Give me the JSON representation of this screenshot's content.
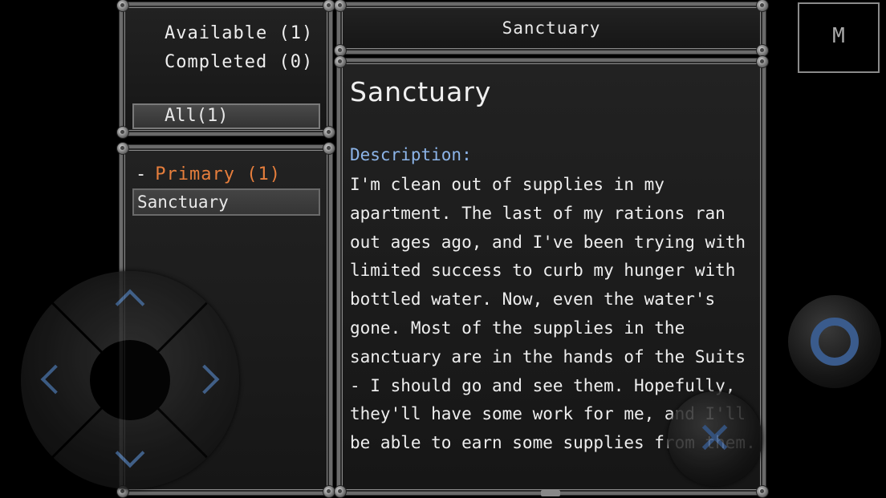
{
  "filters": {
    "available": "Available (1)",
    "completed": "Completed (0)",
    "all_button": "All(1)"
  },
  "quest_list": {
    "category_dash": "-",
    "category": "Primary (1)",
    "items": [
      "Sanctuary"
    ]
  },
  "header": {
    "title": "Sanctuary"
  },
  "quest": {
    "title": "Sanctuary",
    "description_label": "Description:",
    "description": "I'm clean out of supplies in my apartment. The last of my rations ran out ages ago, and I've been trying with limited success to curb my hunger with bottled water. Now, even the water's gone. Most of the supplies in the sanctuary are in the hands of the Suits - I should go and see them. Hopefully, they'll have some work for me, and I'll be able to earn some supplies from them."
  },
  "controls": {
    "map_label": "M",
    "cancel_symbol": "✕",
    "dpad_icon_names": [
      "arrow-up-icon",
      "arrow-down-icon",
      "arrow-left-icon",
      "arrow-right-icon"
    ]
  },
  "colors": {
    "category": "#e67e3c",
    "description_label": "#8cb4e8",
    "control_accent": "#3a5b8c"
  }
}
